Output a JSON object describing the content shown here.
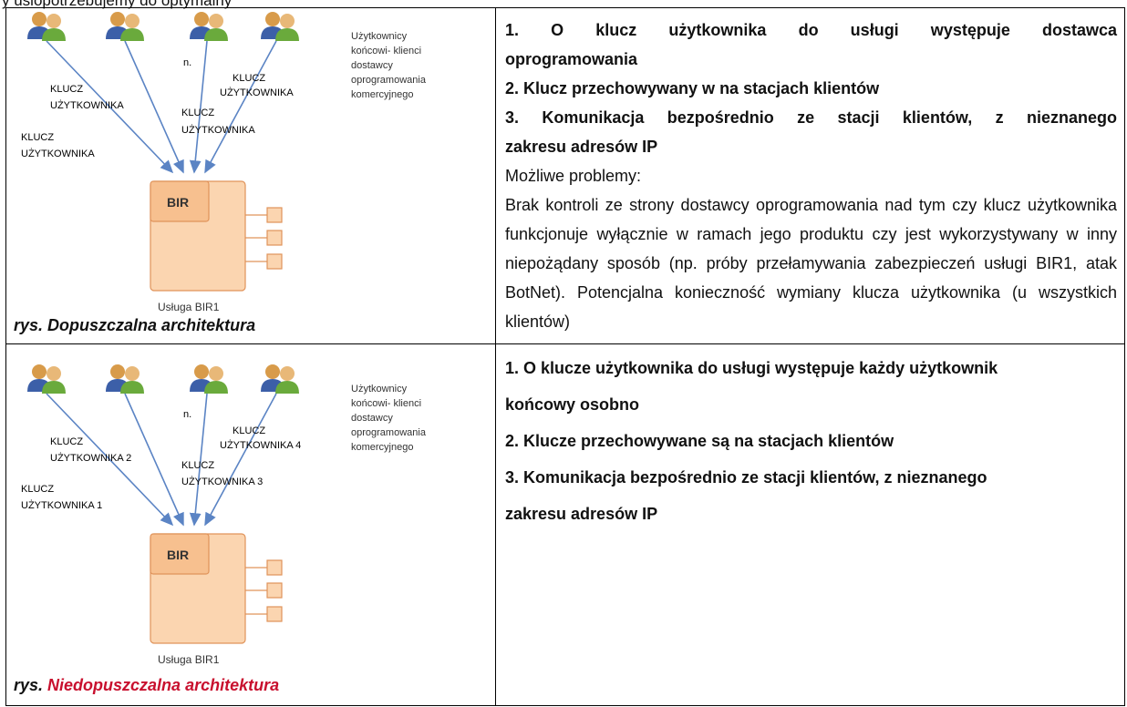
{
  "top_text": "y usiopotrzebujemy do optymalny",
  "left1": {
    "users_text": [
      "Użytkownicy",
      "końcowi- klienci",
      "dostawcy",
      "oprogramowania",
      "komercyjnego"
    ],
    "n_label": "n.",
    "key_labels": [
      {
        "l1": "KLUCZ",
        "l2": "UŻYTKOWNIKA"
      },
      {
        "l1": "KLUCZ",
        "l2": "UŻYTKOWNIKA"
      },
      {
        "l1": "KLUCZ",
        "l2": "UŻYTKOWNIKA"
      },
      {
        "l1": "KLUCZ",
        "l2": "UŻYTKOWNIKA"
      }
    ],
    "bir_label": "BIR",
    "service_label": "Usługa BIR1",
    "caption": "rys. Dopuszczalna architektura"
  },
  "right1": {
    "point1_line1": "1.  O  klucz  użytkownika  do  usługi  występuje  dostawca",
    "point1_line2": "oprogramowania",
    "point2": "2.  Klucz przechowywany w na stacjach klientów",
    "point3_line1": "3.  Komunikacja  bezpośrednio  ze  stacji  klientów,  z  nieznanego",
    "point3_line2": "zakresu adresów IP",
    "problems_title": "Możliwe problemy:",
    "problems_text": "Brak kontroli ze strony dostawcy oprogramowania nad tym czy klucz użytkownika funkcjonuje wyłącznie w ramach jego produktu czy jest wykorzystywany w inny niepożądany sposób (np. próby przełamywania zabezpieczeń usługi BIR1, atak BotNet). Potencjalna konieczność wymiany klucza użytkownika (u wszystkich klientów)"
  },
  "left2": {
    "users_text": [
      "Użytkownicy",
      "końcowi- klienci",
      "dostawcy",
      "oprogramowania",
      "komercyjnego"
    ],
    "n_label": "n.",
    "key_labels": [
      {
        "l1": "KLUCZ",
        "l2": "UŻYTKOWNIKA 2"
      },
      {
        "l1": "KLUCZ",
        "l2": "UŻYTKOWNIKA 1"
      },
      {
        "l1": "KLUCZ",
        "l2": "UŻYTKOWNIKA 4"
      },
      {
        "l1": "KLUCZ",
        "l2": "UŻYTKOWNIKA 3"
      }
    ],
    "bir_label": "BIR",
    "service_label": "Usługa BIR1",
    "caption_prefix": "rys. ",
    "caption_red": "Niedopuszczalna architektura"
  },
  "right2": {
    "point1_line1": "1. O klucze użytkownika do usługi występuje każdy użytkownik",
    "point1_line2": "końcowy osobno",
    "point2": "2. Klucze przechowywane są na stacjach klientów",
    "point3_line1": "3. Komunikacja bezpośrednio ze stacji klientów, z nieznanego",
    "point3_line2": "zakresu adresów IP"
  },
  "colors": {
    "arrow": "#5b84c4",
    "box_fill": "#fbd5b0",
    "box_stroke": "#e0935a",
    "caption_red": "#c8102e"
  }
}
